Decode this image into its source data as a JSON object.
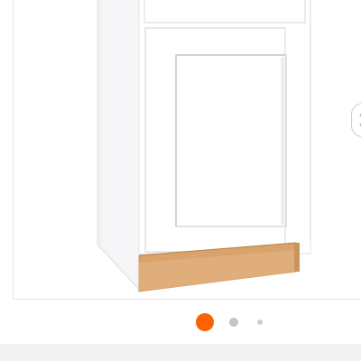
{
  "gallery": {
    "product_image": "base-cabinet-white-shaker",
    "next_icon": "chevron-right-icon",
    "dots": [
      {
        "active": true
      },
      {
        "active": false
      },
      {
        "active": false
      }
    ]
  },
  "colors": {
    "active_dot": "#f96302",
    "inactive_dot": "#c4c4c4",
    "far_dot": "#d0d0d0",
    "frame_border": "#e6e6e6",
    "bottom_bar": "#f2f2f2",
    "cabinet_face": "#ffffff",
    "cabinet_side": "#f3f3f5",
    "toe_kick": "#d9a36b"
  }
}
